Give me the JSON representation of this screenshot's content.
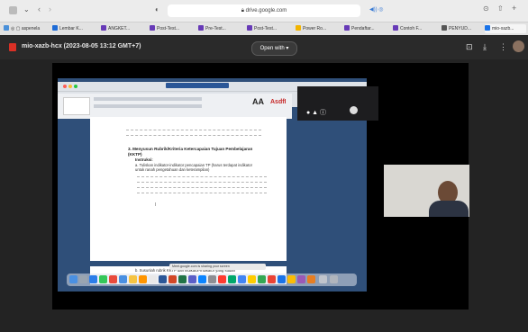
{
  "browser": {
    "url": "drive.google.com",
    "tabs": [
      {
        "label": "Lembar K..."
      },
      {
        "label": "ANGKET..."
      },
      {
        "label": "Post-Test..."
      },
      {
        "label": "Pre-Test..."
      },
      {
        "label": "Post-Test..."
      },
      {
        "label": "Power Ro..."
      },
      {
        "label": "Pendaftar..."
      },
      {
        "label": "Contoh F..."
      },
      {
        "label": "PENYUD..."
      },
      {
        "label": "mio-xazb..."
      }
    ]
  },
  "viewer": {
    "file_title": "mio-xazb-hcx (2023-08-05 13:12 GMT+7)",
    "open_with": "Open with"
  },
  "document": {
    "heading": "3. Menyusun Rubrik/Kriteria Ketercapaian Tujuan Pembelajaran (KKTP)",
    "instruction": "Instruksi:",
    "bullet": "a. Tuliskan indikator-indikator pencapaian TP (harus terdapat indikator untuk ranah pengetahuan dan keterampilan)",
    "bullet2": "b. Susunlah rubrik KKTP dari indikator-indikator yang sudah",
    "asdl": "AsdfI"
  },
  "toast": {
    "text": "Meet.google.com is sharing your screen"
  },
  "colors": {
    "accent_blue": "#1a73e8",
    "pdf_red": "#d93025"
  }
}
